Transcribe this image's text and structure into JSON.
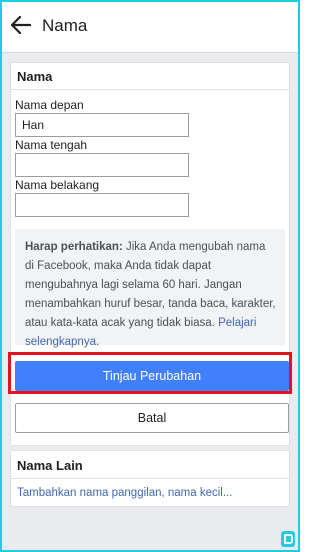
{
  "header": {
    "title": "Nama",
    "back_icon": "arrow-left-icon"
  },
  "name_card": {
    "title": "Nama",
    "first_name_label": "Nama depan",
    "first_name_value": "Han",
    "middle_name_label": "Nama tengah",
    "middle_name_value": "",
    "last_name_label": "Nama belakang",
    "last_name_value": "",
    "notice": {
      "bold": "Harap perhatikan:",
      "text": " Jika Anda mengubah nama di Facebook, maka Anda tidak dapat mengubahnya lagi selama 60 hari. Jangan menambahkan huruf besar, tanda baca, karakter, atau kata-kata acak yang tidak biasa. ",
      "link": "Pelajari selengkapnya",
      "trailing": "."
    },
    "review_button": "Tinjau Perubahan",
    "cancel_button": "Batal"
  },
  "other_names_card": {
    "title": "Nama Lain",
    "add_link": "Tambahkan nama panggilan, nama kecil..."
  },
  "colors": {
    "primary": "#4080ff",
    "link": "#4267b2",
    "highlight": "#e3121d",
    "frame": "#22cbe0"
  }
}
